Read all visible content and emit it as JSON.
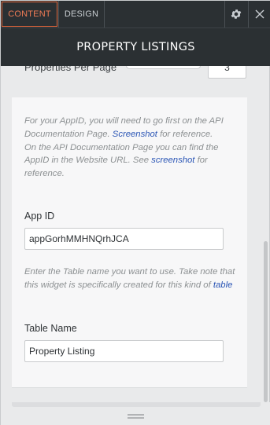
{
  "tabs": {
    "content": "CONTENT",
    "design": "DESIGN"
  },
  "icons": {
    "settings": "gear-icon",
    "close": "close-icon"
  },
  "header": {
    "title": "PROPERTY LISTINGS"
  },
  "properties_per_page": {
    "label": "Properties Per Page",
    "value": "3"
  },
  "info1": {
    "line1_pre": "For your AppID, you will need to go first on the API Documentation Page. ",
    "line1_link": "Screenshot",
    "line1_post": " for reference.",
    "line2_pre": "On the API Documentation Page you can find the AppID in the Website URL. See ",
    "line2_link": "screenshot",
    "line2_post": " for reference."
  },
  "app_id": {
    "label": "App ID",
    "value": "appGorhMMHNQrhJCA"
  },
  "info2": {
    "pre": "Enter the Table name you want to use. Take note that this widget is specifically created for this kind of ",
    "link": "table"
  },
  "table_name": {
    "label": "Table Name",
    "value": "Property Listing"
  },
  "colors": {
    "accent": "#e5673b",
    "header_bg": "#2b3033",
    "link": "#2a55b5"
  }
}
